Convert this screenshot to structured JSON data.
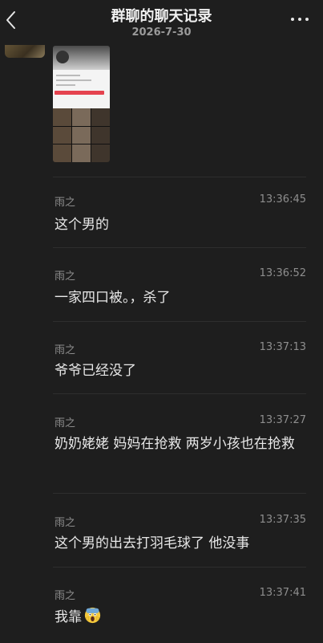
{
  "header": {
    "title": "群聊的聊天记录",
    "date": "2026-7-30"
  },
  "messages": [
    {
      "sender": "雨之",
      "time": "13:36:45",
      "text": "这个男的"
    },
    {
      "sender": "雨之",
      "time": "13:36:52",
      "text": "一家四口被。，杀了"
    },
    {
      "sender": "雨之",
      "time": "13:37:13",
      "text": "爷爷已经没了"
    },
    {
      "sender": "雨之",
      "time": "13:37:27",
      "text": "奶奶姥姥 妈妈在抢救 两岁小孩也在抢救"
    },
    {
      "sender": "雨之",
      "time": "13:37:35",
      "text": "这个男的出去打羽毛球了 他没事"
    },
    {
      "sender": "雨之",
      "time": "13:37:41",
      "text": "我靠",
      "emoji": "scream-emoji"
    }
  ],
  "icons": {
    "back": "chevron-left-icon",
    "more": "more-dots-icon"
  }
}
